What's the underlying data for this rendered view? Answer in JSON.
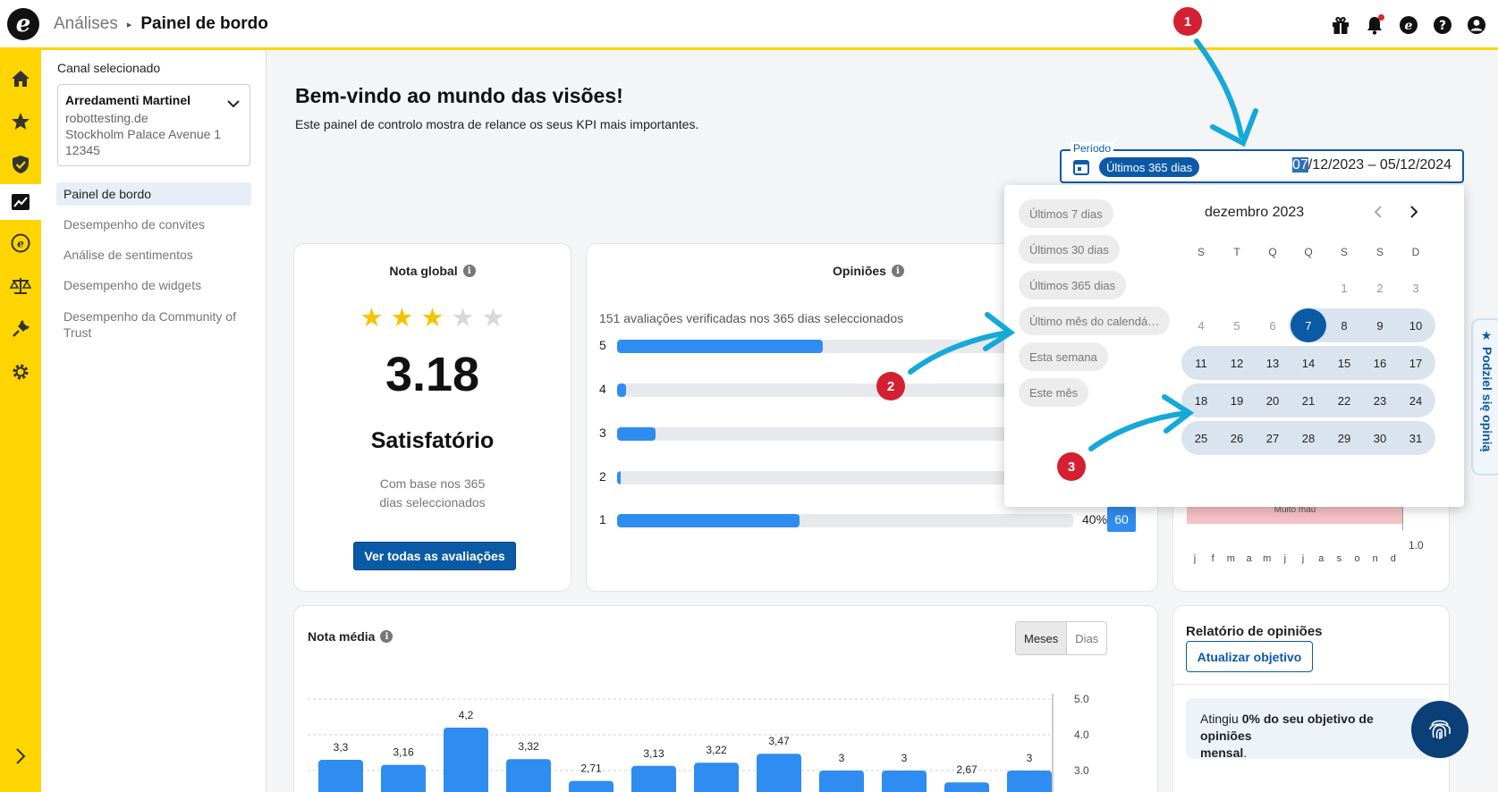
{
  "breadcrumb": {
    "parent": "Análises",
    "current": "Painel de bordo"
  },
  "logo": "e",
  "sidebar": {
    "channel_label": "Canal selecionado",
    "channel": {
      "name": "Arredamenti Martinel",
      "site": "robottesting.de",
      "address": "Stockholm Palace Avenue 1",
      "zip": "12345"
    },
    "items": [
      {
        "label": "Painel de bordo"
      },
      {
        "label": "Desempenho de convites"
      },
      {
        "label": "Análise de sentimentos"
      },
      {
        "label": "Desempenho de widgets"
      },
      {
        "label": "Desempenho da Community of Trust"
      }
    ]
  },
  "welcome": {
    "title": "Bem-vindo ao mundo das visões!",
    "subtitle": "Este painel de controlo mostra de relance os seus KPI mais importantes."
  },
  "period": {
    "label": "Período",
    "chip": "Últimos 365 dias",
    "start_highlight": "07",
    "range_rest": "/12/2023 – 05/12/2024",
    "quick_options": [
      "Últimos 7 dias",
      "Últimos 30 dias",
      "Últimos 365 dias",
      "Último mês do calendá…",
      "Esta semana",
      "Este mês"
    ],
    "calendar": {
      "month": "dezembro 2023",
      "weekdays": [
        "S",
        "T",
        "Q",
        "Q",
        "S",
        "S",
        "D"
      ],
      "selected_day": 7,
      "weeks": [
        [
          "",
          "",
          "",
          "",
          "1",
          "2",
          "3"
        ],
        [
          "4",
          "5",
          "6",
          "7",
          "8",
          "9",
          "10"
        ],
        [
          "11",
          "12",
          "13",
          "14",
          "15",
          "16",
          "17"
        ],
        [
          "18",
          "19",
          "20",
          "21",
          "22",
          "23",
          "24"
        ],
        [
          "25",
          "26",
          "27",
          "28",
          "29",
          "30",
          "31"
        ]
      ]
    }
  },
  "nota_global": {
    "title": "Nota global",
    "stars_filled": 3,
    "stars_total": 5,
    "score": "3.18",
    "rating_word": "Satisfatório",
    "based_line1": "Com base nos 365",
    "based_line2": "dias seleccionados",
    "button": "Ver todas as avaliações"
  },
  "opinioes": {
    "title": "Opiniões",
    "subtitle": "151 avaliações verificadas nos 365 dias seleccionados",
    "rows": [
      {
        "stars": "5",
        "fraction": 0.45
      },
      {
        "stars": "4",
        "fraction": 0.02
      },
      {
        "stars": "3",
        "fraction": 0.085
      },
      {
        "stars": "2",
        "fraction": 0.007
      },
      {
        "stars": "1",
        "fraction": 0.4,
        "pct": "40%",
        "count": "60"
      }
    ]
  },
  "trend_widget": {
    "band_label": "Muito mau",
    "y_tick": "1.0",
    "months": [
      "j",
      "f",
      "m",
      "a",
      "m",
      "j",
      "j",
      "a",
      "s",
      "o",
      "n",
      "d"
    ]
  },
  "nota_media": {
    "title": "Nota média",
    "toggle_selected": "Meses",
    "toggle_other": "Dias"
  },
  "chart_data": {
    "type": "bar",
    "values": [
      3.3,
      3.16,
      4.2,
      3.32,
      2.71,
      3.13,
      3.22,
      3.47,
      3,
      3,
      2.67,
      3
    ],
    "value_labels": [
      "3,3",
      "3,16",
      "4,2",
      "3,32",
      "2,71",
      "3,13",
      "3,22",
      "3,47",
      "3",
      "3",
      "2,67",
      "3"
    ],
    "yticks": [
      "5.0",
      "4.0",
      "3.0"
    ],
    "ylim": [
      2.6,
      5.0
    ],
    "grid": true
  },
  "relatorio": {
    "title": "Relatório de opiniões",
    "button": "Atualizar objetivo",
    "goal_prefix": "Atingiu ",
    "goal_bold": "0%",
    "goal_mid": " do seu objetivo de opiniões",
    "goal_end": "mensal",
    "goal_dot": "."
  },
  "feedback_tab": "★ Podziel się opinią",
  "markers": [
    "1",
    "2",
    "3"
  ],
  "colors": {
    "brand_yellow": "#ffd500",
    "primary_blue": "#0b5aa6",
    "bar_blue": "#2f8cf0",
    "marker_red": "#d42030",
    "arrow_cyan": "#14a9d8"
  }
}
